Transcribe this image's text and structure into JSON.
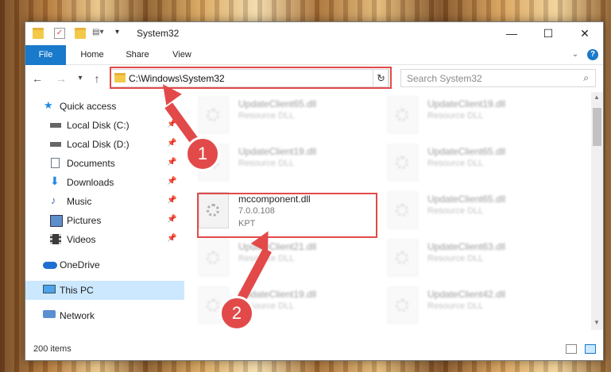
{
  "window": {
    "title": "System32",
    "controls": {
      "minimize": "—",
      "maximize": "☐",
      "close": "✕"
    }
  },
  "ribbon": {
    "tabs": [
      "File",
      "Home",
      "Share",
      "View"
    ],
    "help": "?"
  },
  "navbar": {
    "back": "←",
    "forward": "→",
    "recent": "▾",
    "up": "↑",
    "address": "C:\\Windows\\System32",
    "refresh": "↻",
    "search_placeholder": "Search System32"
  },
  "sidebar": {
    "items": [
      {
        "label": "Quick access",
        "icon": "star-icon",
        "pinned": false
      },
      {
        "label": "Local Disk (C:)",
        "icon": "drive-icon",
        "pinned": true
      },
      {
        "label": "Local Disk (D:)",
        "icon": "drive-icon",
        "pinned": true
      },
      {
        "label": "Documents",
        "icon": "document-icon",
        "pinned": true
      },
      {
        "label": "Downloads",
        "icon": "download-arrow-icon",
        "pinned": true
      },
      {
        "label": "Music",
        "icon": "music-note-icon",
        "pinned": true
      },
      {
        "label": "Pictures",
        "icon": "picture-icon",
        "pinned": true
      },
      {
        "label": "Videos",
        "icon": "film-icon",
        "pinned": true
      },
      {
        "label": "OneDrive",
        "icon": "cloud-icon",
        "pinned": false
      },
      {
        "label": "This PC",
        "icon": "monitor-icon",
        "pinned": false,
        "selected": true
      },
      {
        "label": "Network",
        "icon": "network-icon",
        "pinned": false
      }
    ],
    "pin_glyph": "📌"
  },
  "files": [
    {
      "name": "UpdateClient65.dll",
      "desc": "Resource DLL",
      "blurred": true
    },
    {
      "name": "UpdateClient19.dll",
      "desc": "Resource DLL",
      "blurred": true
    },
    {
      "name": "UpdateClient19.dll",
      "desc": "Resource DLL",
      "blurred": true
    },
    {
      "name": "UpdateClient65.dll",
      "desc": "Resource DLL",
      "blurred": true
    },
    {
      "name": "mccomponent.dll",
      "desc": "7.0.0.108",
      "extra": "KPT",
      "blurred": false
    },
    {
      "name": "UpdateClient65.dll",
      "desc": "Resource DLL",
      "blurred": true
    },
    {
      "name": "UpdateClient21.dll",
      "desc": "Resource DLL",
      "blurred": true
    },
    {
      "name": "UpdateClient63.dll",
      "desc": "Resource DLL",
      "blurred": true
    },
    {
      "name": "UpdateClient19.dll",
      "desc": "Resource DLL",
      "blurred": true
    },
    {
      "name": "UpdateClient42.dll",
      "desc": "Resource DLL",
      "blurred": true
    }
  ],
  "status": {
    "count": "200 items"
  },
  "annotations": {
    "step1": "1",
    "step2": "2",
    "color": "#e24a4a"
  }
}
